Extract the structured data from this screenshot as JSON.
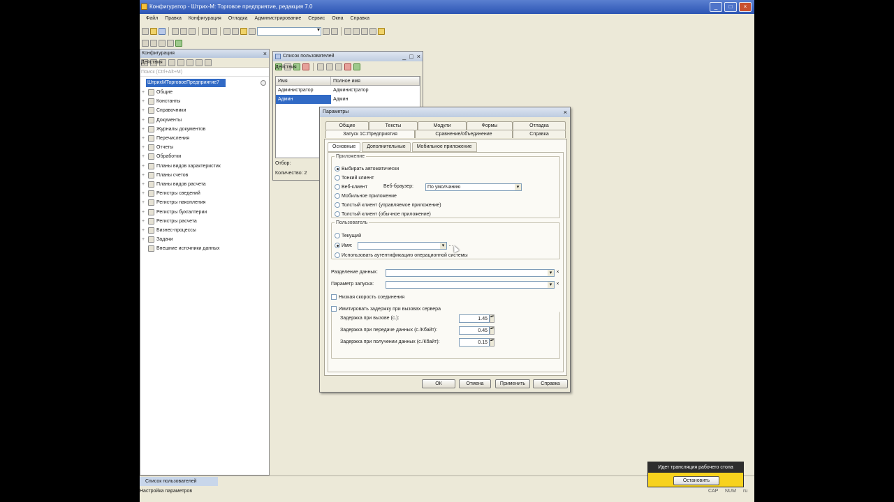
{
  "window": {
    "title": "Конфигуратор - Штрих-М: Торговое предприятие, редакция 7.0"
  },
  "menu": [
    "Файл",
    "Правка",
    "Конфигурация",
    "Отладка",
    "Администрирование",
    "Сервис",
    "Окна",
    "Справка"
  ],
  "config_panel": {
    "title": "Конфигурация",
    "actions_label": "Действия",
    "search_placeholder": "Поиск (Ctrl+Alt+M)",
    "root": "ШтрихМТорговоеПредприятие7",
    "items": [
      "Общие",
      "Константы",
      "Справочники",
      "Документы",
      "Журналы документов",
      "Перечисления",
      "Отчеты",
      "Обработки",
      "Планы видов характеристик",
      "Планы счетов",
      "Планы видов расчета",
      "Регистры сведений",
      "Регистры накопления",
      "Регистры бухгалтерии",
      "Регистры расчета",
      "Бизнес-процессы",
      "Задачи",
      "Внешние источники данных"
    ]
  },
  "users_window": {
    "title": "Список пользователей",
    "actions_label": "Действия",
    "columns": [
      "Имя",
      "Полное имя"
    ],
    "rows": [
      {
        "name": "Администратор",
        "full": "Администратор"
      },
      {
        "name": "Админ",
        "full": "Админ"
      }
    ],
    "selected_row": 1,
    "filter_label": "Отбор:",
    "count_label": "Количество: 2"
  },
  "params_dialog": {
    "title": "Параметры",
    "tabs_row1": [
      "Общие",
      "Тексты",
      "Модули",
      "Формы",
      "Отладка"
    ],
    "tabs_row2": [
      "Запуск 1С:Предприятия",
      "Сравнение/объединение",
      "Справка"
    ],
    "active_tab": "Запуск 1С:Предприятия",
    "subtabs": [
      "Основные",
      "Дополнительные",
      "Мобильное приложение"
    ],
    "app_group": {
      "legend": "Приложение",
      "options": [
        "Выбирать автоматически",
        "Тонкий клиент",
        "Веб-клиент",
        "Мобильное приложение",
        "Толстый клиент (управляемое приложение)",
        "Толстый клиент (обычное приложение)"
      ],
      "selected": 0,
      "browser_label": "Веб-браузер:",
      "browser_value": "По умолчанию"
    },
    "user_group": {
      "legend": "Пользователь",
      "options": [
        "Текущий",
        "Имя:",
        "Использовать аутентификацию операционной системы"
      ],
      "selected": 1,
      "name_value": ""
    },
    "data_separation_label": "Разделение данных:",
    "startup_param_label": "Параметр запуска:",
    "low_speed_label": "Низкая скорость соединения",
    "simulate_delay_label": "Имитировать задержку при вызовах сервера",
    "delays": [
      {
        "label": "Задержка при вызове (с.):",
        "value": "1.45"
      },
      {
        "label": "Задержка при передаче данных (с./Кбайт):",
        "value": "0.45"
      },
      {
        "label": "Задержка при получении данных (с./Кбайт):",
        "value": "0.15"
      }
    ],
    "buttons": {
      "ok": "ОК",
      "cancel": "Отмена",
      "apply": "Применить",
      "help": "Справка"
    }
  },
  "taskbar": {
    "task": "Список пользователей"
  },
  "status": {
    "text": "Настройка параметров",
    "cap": "CAP",
    "num": "NUM",
    "lang": "ru"
  },
  "stream_overlay": {
    "title": "Идет трансляция рабочего стола",
    "stop": "Остановить"
  },
  "colors": {
    "selection": "#316ac5",
    "overlay": "#f7d21d"
  }
}
